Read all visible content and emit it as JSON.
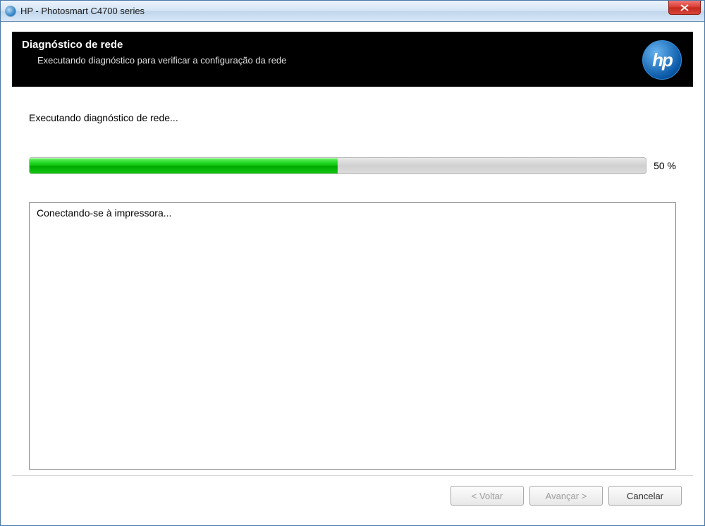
{
  "titlebar": {
    "title": "HP - Photosmart C4700 series"
  },
  "header": {
    "title": "Diagnóstico de rede",
    "subtitle": "Executando diagnóstico para verificar a configuração da rede",
    "logo_text": "hp"
  },
  "status": {
    "line": "Executando diagnóstico de rede..."
  },
  "progress": {
    "percent": 50,
    "label": "50 %",
    "fill_width": "50%"
  },
  "log": {
    "lines": [
      "Conectando-se à impressora..."
    ]
  },
  "buttons": {
    "back": "< Voltar",
    "next": "Avançar >",
    "cancel": "Cancelar"
  }
}
